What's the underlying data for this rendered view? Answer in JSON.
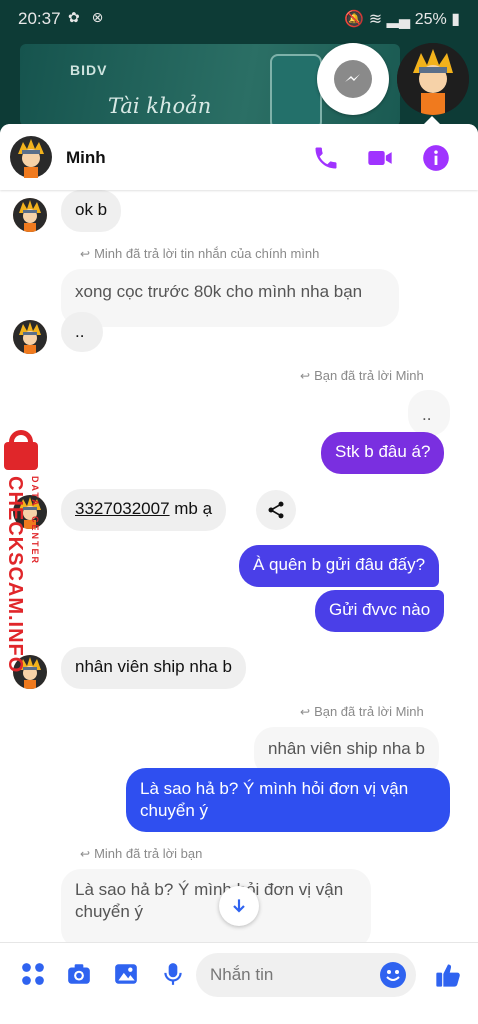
{
  "status": {
    "time": "20:37",
    "battery": "25%"
  },
  "banner": {
    "bank": "BIDV",
    "script": "Tài khoản"
  },
  "header": {
    "name": "Minh"
  },
  "messages": {
    "m1": "ok b",
    "note1": "Minh đã trả lời tin nhắn của chính mình",
    "q1": "xong cọc trước 80k cho mình nha bạn",
    "m2": "..",
    "note2": "Bạn đã trả lời Minh",
    "q2": "..",
    "s1": "Stk b đâu á?",
    "acct_num": "3327032007",
    "acct_suffix": " mb ạ",
    "s2": "À quên b gửi đâu đấy?",
    "s3": "Gửi đvvc nào",
    "m3": "nhân viên ship nha b",
    "note3": "Bạn đã trả lời Minh",
    "q3": "nhân viên ship nha b",
    "s4": "Là sao hả b? Ý mình hỏi đơn vị vận chuyển ý",
    "note4": "Minh đã trả lời bạn",
    "q4": "Là sao hả b? Ý mình hỏi đơn vị vận chuyển ý"
  },
  "composer": {
    "placeholder": "Nhắn tin"
  },
  "watermark": {
    "site": "CHECKSCAM.INFO",
    "sub1": "DATA",
    "sub2": "CENTER"
  },
  "colors": {
    "accent": "#a033ff",
    "sent_top": "#7a2fe0",
    "sent_bottom": "#2f4ff0"
  }
}
